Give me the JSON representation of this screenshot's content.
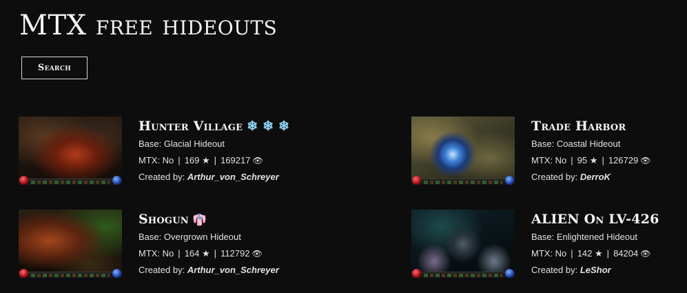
{
  "page": {
    "title": "MTX free hideouts"
  },
  "search": {
    "label": "Search"
  },
  "labels": {
    "base_prefix": "Base: ",
    "mtx_prefix": "MTX: ",
    "created_prefix": "Created by: ",
    "separator": "|",
    "star_icon": "★",
    "eye_icon": "👁"
  },
  "colors": {
    "background": "#0d0d0e",
    "text": "#f4f4f4",
    "badge_snowflake": "#8fd6f3",
    "badge_kimono": "#8fc3f0"
  },
  "hideouts": [
    {
      "title": "Hunter Village",
      "badge": "❄ ❄ ❄",
      "badge_icon": "snowflake-icon",
      "base": "Glacial Hideout",
      "mtx": "No",
      "stars": "169",
      "views": "169217",
      "author": "Arthur_von_Schreyer"
    },
    {
      "title": "Trade Harbor",
      "badge": "",
      "badge_icon": "",
      "base": "Coastal Hideout",
      "mtx": "No",
      "stars": "95",
      "views": "126729",
      "author": "DerroK"
    },
    {
      "title": "Shogun",
      "badge": "👘",
      "badge_icon": "kimono-icon",
      "base": "Overgrown Hideout",
      "mtx": "No",
      "stars": "164",
      "views": "112792",
      "author": "Arthur_von_Schreyer"
    },
    {
      "title": "ALIEN On LV-426",
      "badge": "",
      "badge_icon": "",
      "base": "Enlightened Hideout",
      "mtx": "No",
      "stars": "142",
      "views": "84204",
      "author": "LeShor"
    }
  ]
}
